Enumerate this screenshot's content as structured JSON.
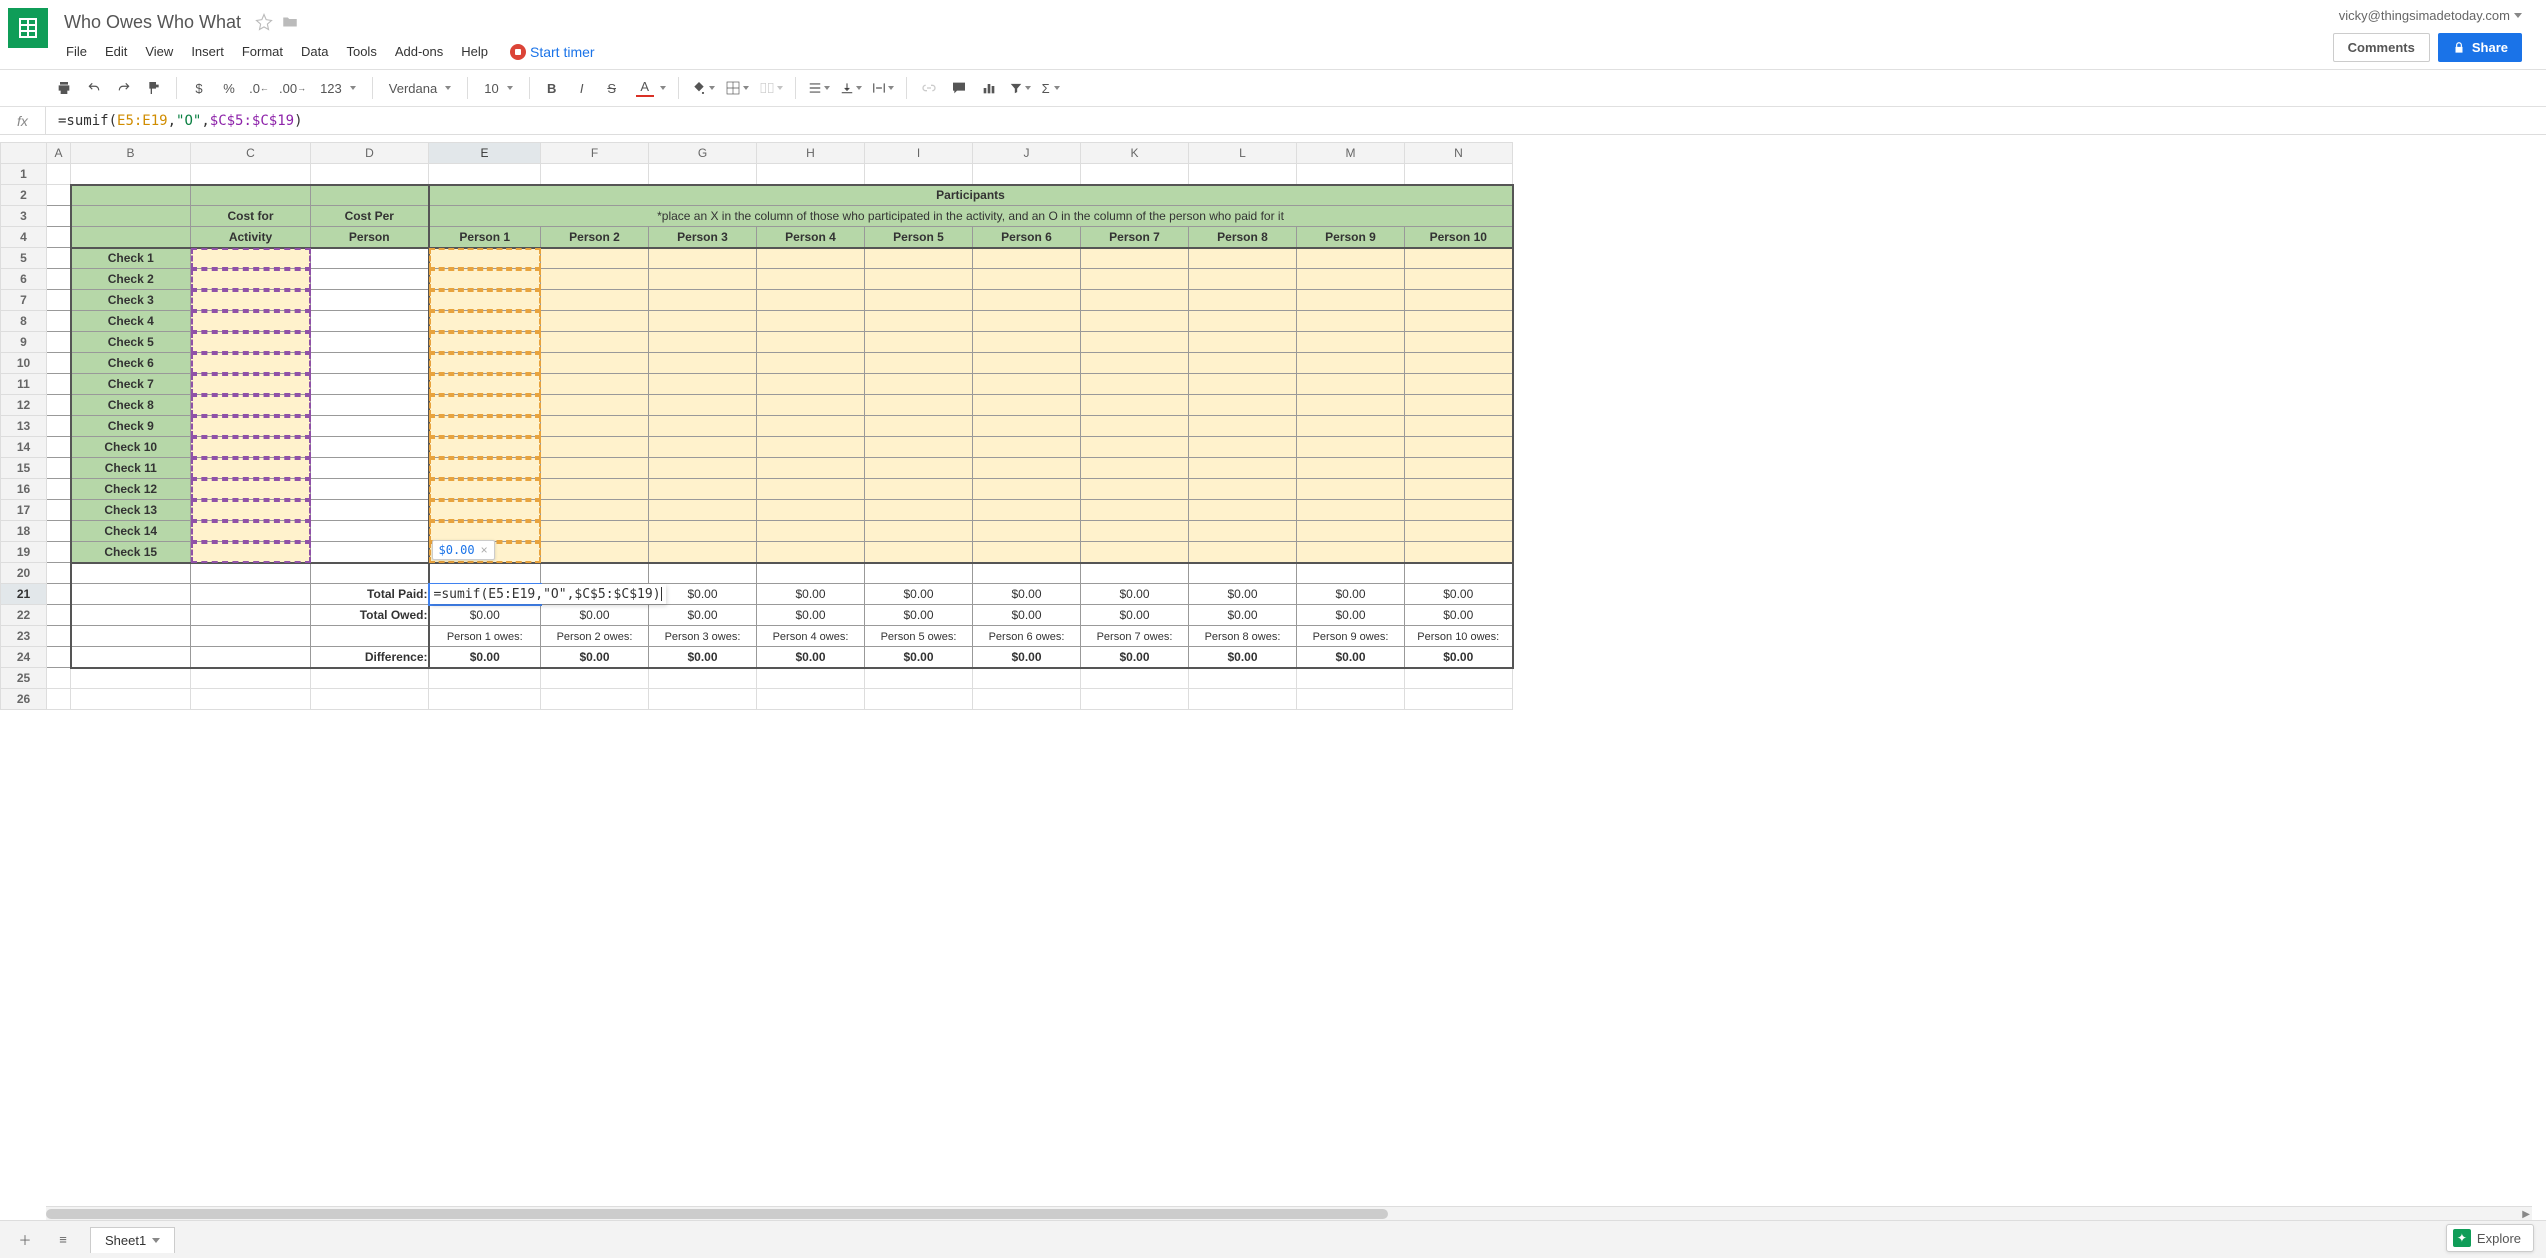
{
  "doc": {
    "title": "Who Owes Who What"
  },
  "account": "vicky@thingsimadetoday.com",
  "buttons": {
    "comments": "Comments",
    "share": "Share",
    "explore": "Explore"
  },
  "menu": [
    "File",
    "Edit",
    "View",
    "Insert",
    "Format",
    "Data",
    "Tools",
    "Add-ons",
    "Help"
  ],
  "timer": "Start timer",
  "toolbar": {
    "font": "Verdana",
    "size": "10",
    "format123": "123"
  },
  "formula_html": "=sumif(<span class='rng1'>E5:E19</span>,<span class='str'>\"O\"</span>,<span class='rng2'>$C$5:$C$19</span>)",
  "formula_plain": "=sumif(E5:E19,\"O\",$C$5:$C$19)",
  "editing_row": 21,
  "editing_col": "E",
  "tooltip_value": "$0.00",
  "columns": [
    "A",
    "B",
    "C",
    "D",
    "E",
    "F",
    "G",
    "H",
    "I",
    "J",
    "K",
    "L",
    "M",
    "N"
  ],
  "sheet": {
    "cost_for_activity": "Cost for Activity",
    "cost_per_person": "Cost Per Person",
    "participants": "Participants",
    "instruction": "*place an X in the column of those who participated in the activity, and an O in the column of the person who paid for it",
    "persons": [
      "Person 1",
      "Person 2",
      "Person 3",
      "Person 4",
      "Person 5",
      "Person 6",
      "Person 7",
      "Person 8",
      "Person 9",
      "Person 10"
    ],
    "checks": [
      "Check 1",
      "Check 2",
      "Check 3",
      "Check 4",
      "Check 5",
      "Check 6",
      "Check 7",
      "Check 8",
      "Check 9",
      "Check 10",
      "Check 11",
      "Check 12",
      "Check 13",
      "Check 14",
      "Check 15"
    ],
    "total_paid_label": "Total Paid:",
    "total_owed_label": "Total Owed:",
    "difference_label": "Difference:",
    "total_paid": [
      "$0.00",
      "$0.00",
      "$0.00",
      "$0.00",
      "$0.00",
      "$0.00",
      "$0.00",
      "$0.00",
      "$0.00"
    ],
    "paid_first_extra": "$0.00",
    "total_owed": [
      "$0.00",
      "$0.00",
      "$0.00",
      "$0.00",
      "$0.00",
      "$0.00",
      "$0.00",
      "$0.00",
      "$0.00",
      "$0.00"
    ],
    "owes_labels": [
      "Person 1 owes:",
      "Person 2 owes:",
      "Person 3 owes:",
      "Person 4 owes:",
      "Person 5 owes:",
      "Person 6 owes:",
      "Person 7 owes:",
      "Person 8 owes:",
      "Person 9 owes:",
      "Person 10 owes:"
    ],
    "difference": [
      "$0.00",
      "$0.00",
      "$0.00",
      "$0.00",
      "$0.00",
      "$0.00",
      "$0.00",
      "$0.00",
      "$0.00",
      "$0.00"
    ]
  },
  "tabs": {
    "sheet1": "Sheet1"
  }
}
